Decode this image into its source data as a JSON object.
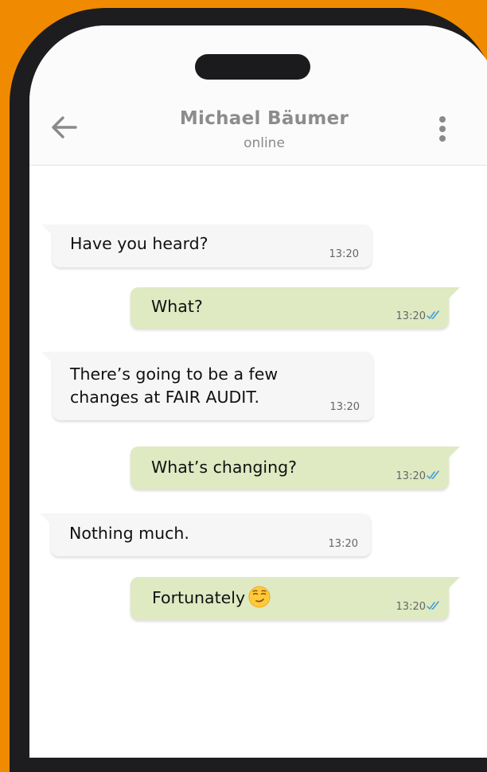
{
  "contact": {
    "name": "Michael Bäumer",
    "status": "online"
  },
  "messages": [
    {
      "direction": "in",
      "text": "Have you heard?",
      "time": "13:20"
    },
    {
      "direction": "out",
      "text": "What?",
      "time": "13:20",
      "read": true
    },
    {
      "direction": "in",
      "text_lines": [
        "There’s going to be a few",
        "changes at FAIR AUDIT."
      ],
      "time": "13:20"
    },
    {
      "direction": "out",
      "text": "What’s changing?",
      "time": "13:20",
      "read": true
    },
    {
      "direction": "in",
      "text": "Nothing much.",
      "time": "13:20"
    },
    {
      "direction": "out",
      "text": "Fortunately",
      "emoji": "smirking-face-icon",
      "time": "13:20",
      "read": true
    }
  ],
  "colors": {
    "background": "#f08a00",
    "incoming_bubble": "#f6f6f6",
    "outgoing_bubble": "#dfe9c2",
    "read_check": "#3f9bd6"
  }
}
